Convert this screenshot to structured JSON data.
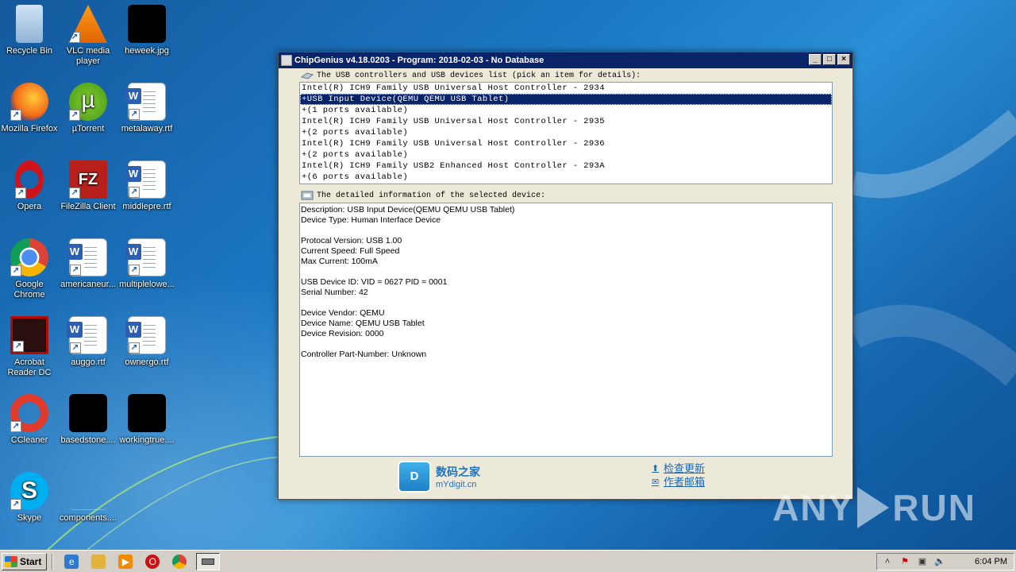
{
  "desktop": {
    "icons": [
      {
        "label": "Recycle Bin",
        "icon": "recycle-bin-icon"
      },
      {
        "label": "VLC media player",
        "icon": "vlc-icon"
      },
      {
        "label": "heweek.jpg",
        "icon": "image-file-icon"
      },
      {
        "label": "Mozilla Firefox",
        "icon": "firefox-icon"
      },
      {
        "label": "µTorrent",
        "icon": "utorrent-icon"
      },
      {
        "label": "metalaway.rtf",
        "icon": "word-doc-icon"
      },
      {
        "label": "Opera",
        "icon": "opera-icon"
      },
      {
        "label": "FileZilla Client",
        "icon": "filezilla-icon"
      },
      {
        "label": "middlepre.rtf",
        "icon": "word-doc-icon"
      },
      {
        "label": "Google Chrome",
        "icon": "chrome-icon"
      },
      {
        "label": "americaneur...",
        "icon": "word-doc-icon"
      },
      {
        "label": "multiplelowe...",
        "icon": "word-doc-icon"
      },
      {
        "label": "Acrobat Reader DC",
        "icon": "acrobat-icon"
      },
      {
        "label": "auggo.rtf",
        "icon": "word-doc-icon"
      },
      {
        "label": "ownergo.rtf",
        "icon": "word-doc-icon"
      },
      {
        "label": "CCleaner",
        "icon": "ccleaner-icon"
      },
      {
        "label": "basedstone....",
        "icon": "image-file-icon"
      },
      {
        "label": "workingtrue....",
        "icon": "image-file-icon"
      },
      {
        "label": "Skype",
        "icon": "skype-icon"
      },
      {
        "label": "components....",
        "icon": "blank-file-icon"
      }
    ]
  },
  "window": {
    "title": "ChipGenius v4.18.0203 - Program: 2018-02-03 - No Database",
    "minimize": "_",
    "maximize": "□",
    "close": "×",
    "list_header": "The USB controllers and USB devices list (pick an item for details):",
    "devices": [
      {
        "text": "Intel(R) ICH9 Family USB Universal Host Controller - 2934",
        "selected": false
      },
      {
        "text": "+USB Input Device(QEMU QEMU USB Tablet)",
        "selected": true
      },
      {
        "text": "+(1 ports available)",
        "selected": false
      },
      {
        "text": "Intel(R) ICH9 Family USB Universal Host Controller - 2935",
        "selected": false
      },
      {
        "text": "+(2 ports available)",
        "selected": false
      },
      {
        "text": "Intel(R) ICH9 Family USB Universal Host Controller - 2936",
        "selected": false
      },
      {
        "text": "+(2 ports available)",
        "selected": false
      },
      {
        "text": "Intel(R) ICH9 Family USB2 Enhanced Host Controller - 293A",
        "selected": false
      },
      {
        "text": "+(6 ports available)",
        "selected": false
      }
    ],
    "detail_header": "The detailed information of the selected device:",
    "details": [
      "Description: USB Input Device(QEMU QEMU USB Tablet)",
      "Device Type: Human Interface Device",
      "",
      "Protocal Version: USB 1.00",
      "Current Speed: Full Speed",
      "Max Current: 100mA",
      "",
      "USB Device ID: VID = 0627 PID = 0001",
      "Serial Number: 42",
      "",
      "Device Vendor: QEMU",
      "Device Name: QEMU USB Tablet",
      "Device Revision: 0000",
      "",
      "Controller Part-Number: Unknown"
    ],
    "logo": {
      "mark": "D",
      "cn": "数码之家",
      "en": "mYdigit.cn"
    },
    "links": {
      "update": "检查更新",
      "mail": "作者邮箱"
    }
  },
  "watermark": {
    "left": "ANY",
    "right": "RUN"
  },
  "taskbar": {
    "start_label": "Start",
    "clock": "6:04 PM"
  }
}
